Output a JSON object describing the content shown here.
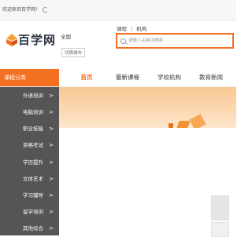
{
  "topbar": {
    "welcome": "欢迎来到百学网！"
  },
  "header": {
    "logo_text": "百学网",
    "city": "全国",
    "switch_city": "切换城市",
    "search_tabs": [
      "课程",
      "机构"
    ],
    "search_placeholder": "请输入关键词搜索"
  },
  "nav": {
    "category_header": "课程分类",
    "items": [
      "首页",
      "最新课程",
      "学校机构",
      "教育新闻"
    ],
    "active_index": 0
  },
  "sidebar": {
    "items": [
      "外语培训",
      "电脑培训",
      "职业技能",
      "资格考试",
      "学历提升",
      "文体艺术",
      "学习辅导",
      "留学培训",
      "其他综合"
    ]
  },
  "colors": {
    "accent": "#f36f22",
    "sidebar_bg": "#555555"
  }
}
